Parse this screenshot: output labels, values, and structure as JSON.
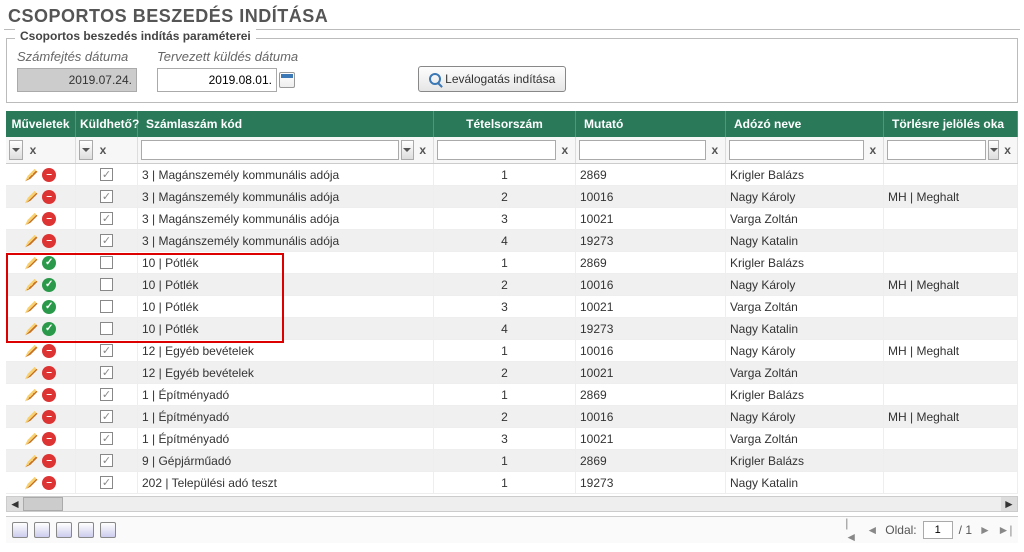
{
  "page_title": "CSOPORTOS BESZEDÉS INDÍTÁSA",
  "params": {
    "legend": "Csoportos beszedés indítás paraméterei",
    "date_calc_label": "Számfejtés dátuma",
    "date_calc_value": "2019.07.24.",
    "date_send_label": "Tervezett küldés dátuma",
    "date_send_value": "2019.08.01.",
    "filter_button": "Leválogatás indítása"
  },
  "columns": {
    "ops": "Műveletek",
    "sendable": "Küldhető?",
    "code": "Számlaszám kód",
    "line": "Tételsorszám",
    "mutato": "Mutató",
    "name": "Adózó neve",
    "reason": "Törlésre jelölés oka"
  },
  "rows": [
    {
      "status": "red",
      "checked": true,
      "code": "3 | Magánszemély kommunális adója",
      "line": "1",
      "mutato": "2869",
      "name": "Krigler Balázs",
      "reason": ""
    },
    {
      "status": "red",
      "checked": true,
      "code": "3 | Magánszemély kommunális adója",
      "line": "2",
      "mutato": "10016",
      "name": "Nagy Károly",
      "reason": "MH | Meghalt"
    },
    {
      "status": "red",
      "checked": true,
      "code": "3 | Magánszemély kommunális adója",
      "line": "3",
      "mutato": "10021",
      "name": "Varga Zoltán",
      "reason": ""
    },
    {
      "status": "red",
      "checked": true,
      "code": "3 | Magánszemély kommunális adója",
      "line": "4",
      "mutato": "19273",
      "name": "Nagy Katalin",
      "reason": ""
    },
    {
      "status": "green",
      "checked": false,
      "code": "10 | Pótlék",
      "line": "1",
      "mutato": "2869",
      "name": "Krigler Balázs",
      "reason": ""
    },
    {
      "status": "green",
      "checked": false,
      "code": "10 | Pótlék",
      "line": "2",
      "mutato": "10016",
      "name": "Nagy Károly",
      "reason": "MH | Meghalt"
    },
    {
      "status": "green",
      "checked": false,
      "code": "10 | Pótlék",
      "line": "3",
      "mutato": "10021",
      "name": "Varga Zoltán",
      "reason": ""
    },
    {
      "status": "green",
      "checked": false,
      "code": "10 | Pótlék",
      "line": "4",
      "mutato": "19273",
      "name": "Nagy Katalin",
      "reason": ""
    },
    {
      "status": "red",
      "checked": true,
      "code": "12 | Egyéb bevételek",
      "line": "1",
      "mutato": "10016",
      "name": "Nagy Károly",
      "reason": "MH | Meghalt"
    },
    {
      "status": "red",
      "checked": true,
      "code": "12 | Egyéb bevételek",
      "line": "2",
      "mutato": "10021",
      "name": "Varga Zoltán",
      "reason": ""
    },
    {
      "status": "red",
      "checked": true,
      "code": "1 | Építményadó",
      "line": "1",
      "mutato": "2869",
      "name": "Krigler Balázs",
      "reason": ""
    },
    {
      "status": "red",
      "checked": true,
      "code": "1 | Építményadó",
      "line": "2",
      "mutato": "10016",
      "name": "Nagy Károly",
      "reason": "MH | Meghalt"
    },
    {
      "status": "red",
      "checked": true,
      "code": "1 | Építményadó",
      "line": "3",
      "mutato": "10021",
      "name": "Varga Zoltán",
      "reason": ""
    },
    {
      "status": "red",
      "checked": true,
      "code": "9 | Gépjárműadó",
      "line": "1",
      "mutato": "2869",
      "name": "Krigler Balázs",
      "reason": ""
    },
    {
      "status": "red",
      "checked": true,
      "code": "202 | Települési adó teszt",
      "line": "1",
      "mutato": "19273",
      "name": "Nagy Katalin",
      "reason": ""
    }
  ],
  "pager": {
    "label": "Oldal:",
    "current": "1",
    "total": "/ 1"
  }
}
